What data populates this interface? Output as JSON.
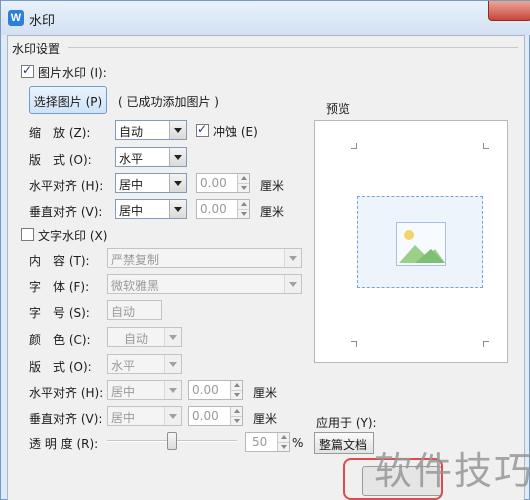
{
  "window": {
    "title": "水印",
    "app_icon_letter": "W"
  },
  "group_title": "水印设置",
  "image_watermark": {
    "checkbox_label": "图片水印 (I):",
    "checked": true,
    "select_button": "选择图片 (P)",
    "status": "( 已成功添加图片 )",
    "scale_label": "缩　放 (Z):",
    "scale_value": "自动",
    "washout_label": "冲蚀 (E)",
    "washout_checked": true,
    "layout_label": "版　式 (O):",
    "layout_value": "水平",
    "h_align_label": "水平对齐 (H):",
    "h_align_value": "居中",
    "h_offset": "0.00",
    "h_unit": "厘米",
    "v_align_label": "垂直对齐 (V):",
    "v_align_value": "居中",
    "v_offset": "0.00",
    "v_unit": "厘米"
  },
  "text_watermark": {
    "checkbox_label": "文字水印 (X)",
    "checked": false,
    "content_label": "内　容 (T):",
    "content_value": "严禁复制",
    "font_label": "字　体 (F):",
    "font_value": "微软雅黑",
    "size_label": "字　号 (S):",
    "size_value": "自动",
    "color_label": "颜　色 (C):",
    "color_value": "自动",
    "layout_label": "版　式 (O):",
    "layout_value": "水平",
    "h_align_label": "水平对齐 (H):",
    "h_align_value": "居中",
    "h_offset": "0.00",
    "h_unit": "厘米",
    "v_align_label": "垂直对齐 (V):",
    "v_align_value": "居中",
    "v_offset": "0.00",
    "v_unit": "厘米",
    "transparency_label": "透 明 度 (R):",
    "transparency_value": "50",
    "transparency_unit": "%",
    "transparency_level": 0.5
  },
  "preview": {
    "label": "预览"
  },
  "apply": {
    "label": "应用于 (Y):",
    "value": "整篇文档"
  },
  "overlay_watermark": "软件技巧",
  "colors": {
    "accent": "#2d7fd8",
    "highlight": "#e04a4a"
  }
}
